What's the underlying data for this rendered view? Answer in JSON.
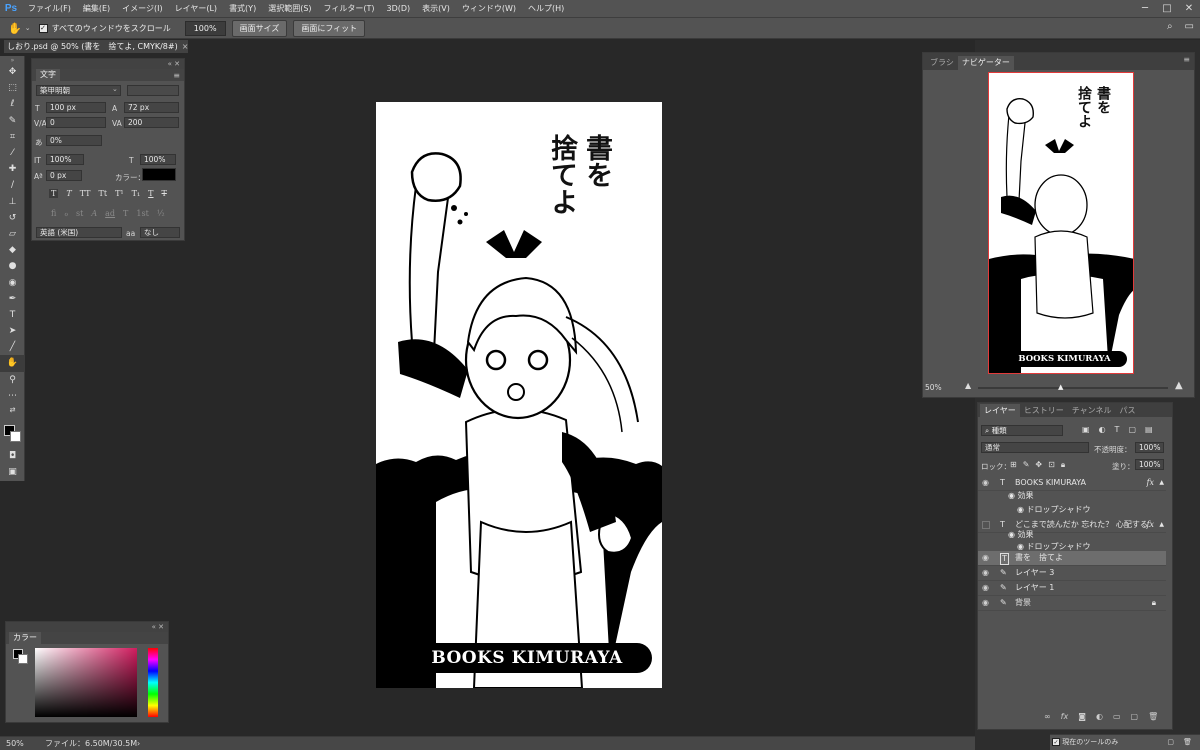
{
  "app": {
    "logo": "Ps",
    "menu": [
      "ファイル(F)",
      "編集(E)",
      "イメージ(I)",
      "レイヤー(L)",
      "書式(Y)",
      "選択範囲(S)",
      "フィルター(T)",
      "3D(D)",
      "表示(V)",
      "ウィンドウ(W)",
      "ヘルプ(H)"
    ],
    "window_controls": [
      "─",
      "□",
      "✕"
    ]
  },
  "options_bar": {
    "scroll_all_label": "すべてのウィンドウをスクロール",
    "scroll_all_checked": true,
    "zoom_value": "100%",
    "screen_size_label": "画面サイズ",
    "fit_screen_label": "画面にフィット"
  },
  "document": {
    "tab_title": "しおり.psd @ 50% (書を　捨てよ, CMYK/8#)",
    "close": "×"
  },
  "status_bar": {
    "zoom": "50%",
    "file_info": "ファイル：6.50M/30.5M",
    "arrow": "›"
  },
  "character_panel": {
    "tab_label": "文字",
    "font_family": "築甲明朝",
    "font_size": "100 px",
    "leading": "72 px",
    "kerning": "0",
    "tracking": "200",
    "tsume": "0%",
    "vertical_scale": "100%",
    "horizontal_scale": "100%",
    "baseline_shift": "0 px",
    "color_label": "カラー：",
    "text_color": "#000000",
    "style_buttons": [
      "T",
      "T",
      "TT",
      "Tt",
      "T¹",
      "T₁",
      "T",
      "T"
    ],
    "opentype_buttons": [
      "fi",
      "ℴ",
      "st",
      "A",
      "ad",
      "T",
      "1st",
      "½"
    ],
    "language": "英語 (米国)",
    "antialias_prefix": "aa",
    "antialias": "なし"
  },
  "color_panel": {
    "tab_label": "カラー",
    "foreground": "#000000",
    "background": "#ffffff",
    "hue_color": "#d01c5e"
  },
  "canvas": {
    "title_col1": "書を",
    "title_col2": "捨てよ",
    "banner_text": "BOOKS KIMURAYA"
  },
  "navigator_panel": {
    "tabs": [
      "ブラシ",
      "ナビゲーター"
    ],
    "active_tab": "ナビゲーター",
    "zoom": "50%"
  },
  "layers_panel": {
    "tabs": [
      "レイヤー",
      "ヒストリー",
      "チャンネル",
      "パス"
    ],
    "active_tab": "レイヤー",
    "filter_label": "種類",
    "blend_mode": "通常",
    "opacity_label": "不透明度：",
    "opacity": "100%",
    "lock_label": "ロック：",
    "fill_label": "塗り：",
    "fill": "100%",
    "layers": [
      {
        "name": "BOOKS KIMURAYA",
        "kind": "T",
        "visible": true,
        "fx": "fx",
        "effects_label": "効果",
        "effect": "ドロップシャドウ"
      },
      {
        "name": "どこまで読んだか  忘れた？  心配する...",
        "kind": "T",
        "visible": false,
        "fx": "fx",
        "effects_label": "効果",
        "effect": "ドロップシャドウ"
      },
      {
        "name": "書を　捨てよ",
        "kind": "T",
        "visible": true,
        "selected": true
      },
      {
        "name": "レイヤー 3",
        "kind": "brush",
        "visible": true
      },
      {
        "name": "レイヤー 1",
        "kind": "brush",
        "visible": true
      },
      {
        "name": "背景",
        "kind": "brush",
        "visible": true,
        "locked": true
      }
    ]
  },
  "bottom_strip": {
    "label": "現在のツールのみ"
  }
}
